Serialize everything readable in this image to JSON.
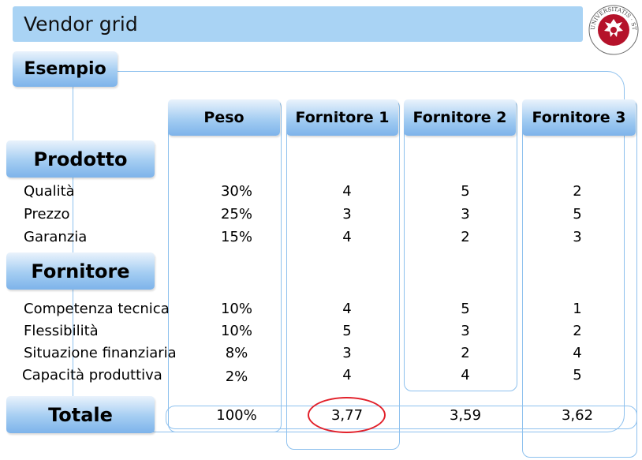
{
  "slide": {
    "title": "Vendor grid",
    "section": "Esempio"
  },
  "header": [
    "Peso",
    "Fornitore 1",
    "Fornitore 2",
    "Fornitore 3"
  ],
  "groups": {
    "prodotto": {
      "label": "Prodotto",
      "rows": [
        {
          "name": "Qualità",
          "peso": "30%",
          "f1": "4",
          "f2": "5",
          "f3": "2"
        },
        {
          "name": "Prezzo",
          "peso": "25%",
          "f1": "3",
          "f2": "3",
          "f3": "5"
        },
        {
          "name": "Garanzia",
          "peso": "15%",
          "f1": "4",
          "f2": "2",
          "f3": "3"
        }
      ]
    },
    "fornitore": {
      "label": "Fornitore",
      "rows": [
        {
          "name": "Competenza tecnica",
          "peso": "10%",
          "f1": "4",
          "f2": "5",
          "f3": "1"
        },
        {
          "name": "Flessibilità",
          "peso": "10%",
          "f1": "5",
          "f2": "3",
          "f3": "2"
        },
        {
          "name": "Situazione finanziaria",
          "peso": "8%",
          "f1": "3",
          "f2": "2",
          "f3": "4"
        },
        {
          "name": "Capacità produttiva",
          "peso": "2%",
          "f1": "4",
          "f2": "4",
          "f3": "5"
        }
      ]
    }
  },
  "totale": {
    "label": "Totale",
    "peso": "100%",
    "f1": "3,77",
    "f2": "3,59",
    "f3": "3,62"
  },
  "colors": {
    "accent_light": "#a9d3f4",
    "tab_gradient_dark": "#7db3ea",
    "highlight": "#e2202a",
    "seal_red": "#b5122a"
  },
  "logo": {
    "name": "university-seal",
    "text": "UNIVERSITATIS STUDIORUM"
  }
}
